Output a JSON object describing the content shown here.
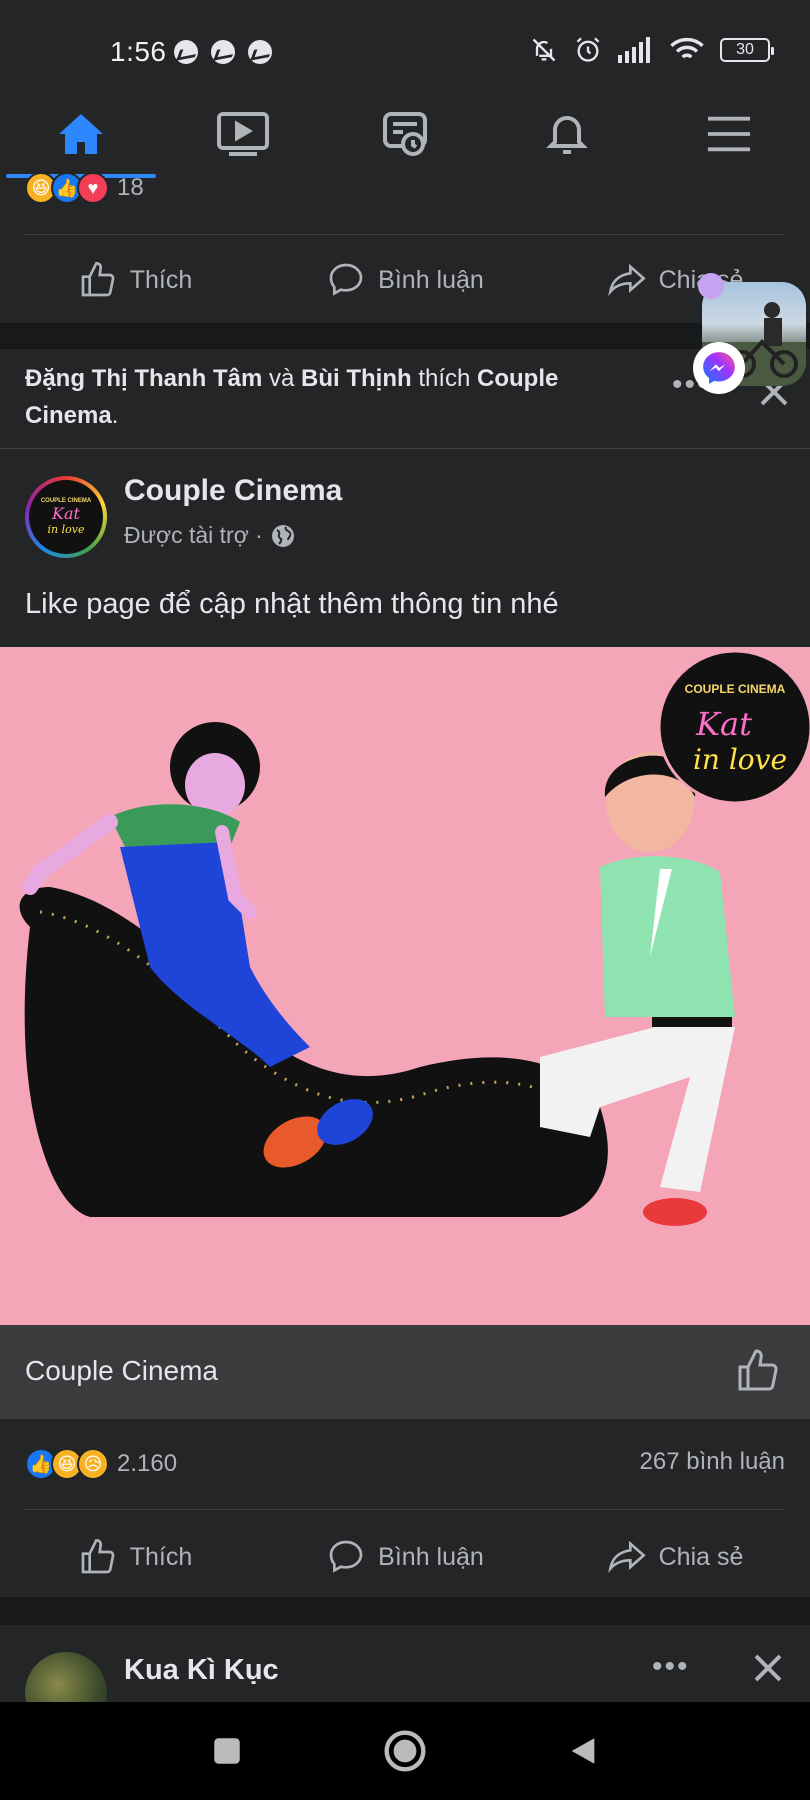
{
  "status": {
    "time": "1:56",
    "battery": "30"
  },
  "nav": {
    "home": "home-icon",
    "watch": "video-icon",
    "memories": "memories-icon",
    "notifications": "bell-icon",
    "menu": "menu-icon"
  },
  "prev_post": {
    "reaction_count": "18",
    "like_label": "Thích",
    "comment_label": "Bình luận",
    "share_label": "Chia sẻ"
  },
  "liked_by": {
    "user1": "Đặng Thị Thanh Tâm",
    "conj": " và ",
    "user2": "Bùi Thịnh",
    "verb": " thích ",
    "page": "Couple Cinema",
    "end": "."
  },
  "post": {
    "page_name": "Couple Cinema",
    "sponsored": "Được tài trợ ·",
    "text": "Like page để cập nhật thêm thông tin nhé",
    "logo_top": "COUPLE CINEMA",
    "logo_line1": "Kat",
    "logo_line2": "in love",
    "footer_title": "Couple Cinema",
    "reaction_count": "2.160",
    "comments": "267 bình luận",
    "like_label": "Thích",
    "comment_label": "Bình luận",
    "share_label": "Chia sẻ"
  },
  "next_post": {
    "author": "Kua Kì Kục"
  },
  "colors": {
    "accent": "#2d88ff",
    "bg": "#242526",
    "separator": "#18191a",
    "ad_bg": "#f5a5b8"
  }
}
